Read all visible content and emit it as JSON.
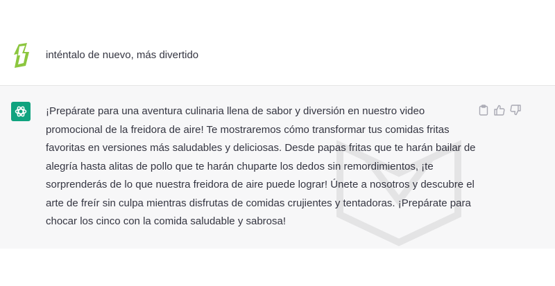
{
  "conversation": {
    "user_message": "inténtalo de nuevo, más divertido",
    "assistant_message": "¡Prepárate para una aventura culinaria llena de sabor y diversión en nuestro video promocional de la freidora de aire! Te mostraremos cómo transformar tus comidas fritas favoritas en versiones más saludables y deliciosas. Desde papas fritas que te harán bailar de alegría hasta alitas de pollo que te harán chuparte los dedos sin remordimientos, ¡te sorprenderás de lo que nuestra freidora de aire puede lograr! Únete a nosotros y descubre el arte de freír sin culpa mientras disfrutas de comidas crujientes y tentadoras. ¡Prepárate para chocar los cinco con la comida saludable y sabrosa!"
  },
  "icons": {
    "user_avatar": "user-avatar-icon",
    "assistant_avatar": "openai-logo-icon",
    "copy": "clipboard-icon",
    "like": "thumbs-up-icon",
    "dislike": "thumbs-down-icon",
    "watermark": "watermark-logo"
  },
  "colors": {
    "assistant_bg": "#f7f7f8",
    "bot_avatar_bg": "#10a37f",
    "user_avatar": "#8cc63f",
    "text": "#343541",
    "icon": "#a9a9b3"
  }
}
